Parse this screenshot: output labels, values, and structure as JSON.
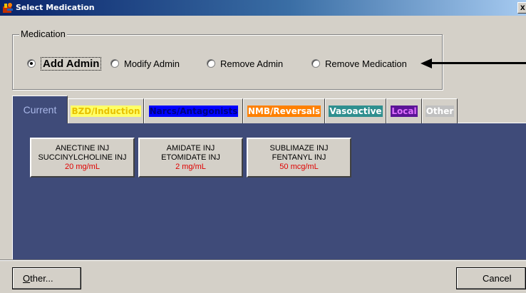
{
  "window": {
    "title": "Select Medication",
    "close_label": "x"
  },
  "medication_group": {
    "legend": "Medication",
    "options": [
      {
        "label": "Add Admin",
        "selected": true
      },
      {
        "label": "Modify Admin",
        "selected": false
      },
      {
        "label": "Remove Admin",
        "selected": false
      },
      {
        "label": "Remove Medication",
        "selected": false
      }
    ]
  },
  "tabs": [
    {
      "label": "Current",
      "bg": "#3f4b79",
      "fg": "#a9b7e8",
      "active": true
    },
    {
      "label": "BZD/Induction",
      "bg": "#ffff66",
      "fg": "#e8c000"
    },
    {
      "label": "Narcs/Antagonists",
      "bg": "#0000ff",
      "fg": "#000080"
    },
    {
      "label": "NMB/Reversals",
      "bg": "#ff8000",
      "fg": "#ffffff"
    },
    {
      "label": "Vasoactive",
      "bg": "#2f8f8f",
      "fg": "#ffffff"
    },
    {
      "label": "Local",
      "bg": "#5b1497",
      "fg": "#e070ff"
    },
    {
      "label": "Other",
      "bg": "#c0c0c0",
      "fg": "#ffffff"
    }
  ],
  "medications": [
    {
      "line1": "ANECTINE INJ",
      "line2": "SUCCINYLCHOLINE INJ",
      "concentration": "20 mg/mL"
    },
    {
      "line1": "AMIDATE INJ",
      "line2": "ETOMIDATE INJ",
      "concentration": "2 mg/mL"
    },
    {
      "line1": "SUBLIMAZE INJ",
      "line2": "FENTANYL INJ",
      "concentration": "50 mcg/mL"
    }
  ],
  "footer": {
    "other_label_mnemonic": "O",
    "other_label_rest": "ther...",
    "cancel_label": "Cancel"
  },
  "colors": {
    "panel": "#3f4b79",
    "concentration_text": "#e00000"
  }
}
